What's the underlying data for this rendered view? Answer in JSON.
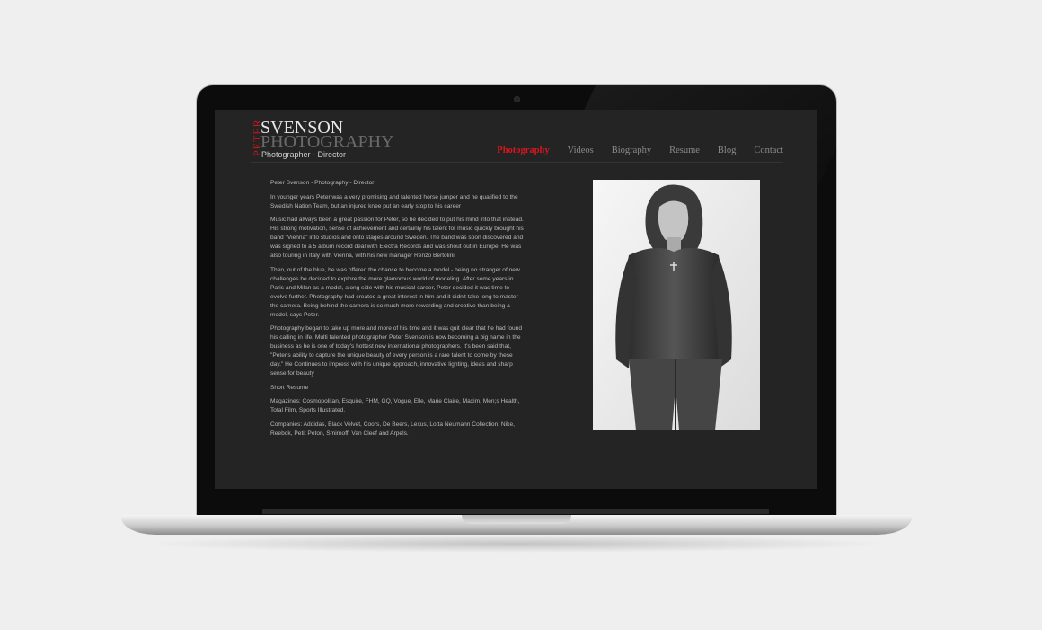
{
  "site": {
    "logo_peter": "PETER",
    "logo_svenson": "SVENSON",
    "logo_photography": "PHOTOGRAPHY",
    "logo_subtitle": "Photographer - Director"
  },
  "nav": {
    "items": [
      {
        "label": "Photography",
        "active": true
      },
      {
        "label": "Videos",
        "active": false
      },
      {
        "label": "Biography",
        "active": false
      },
      {
        "label": "Resume",
        "active": false
      },
      {
        "label": "Blog",
        "active": false
      },
      {
        "label": "Contact",
        "active": false
      }
    ]
  },
  "content": {
    "heading": "Peter Svenson - Photography - Director",
    "paragraphs": [
      "In younger years Peter was a very promising and talented horse jumper and he qualified to the Swedish Nation Team, but an injured knee put an early stop to his career",
      "Music had always been a great passion for Peter, so he decided to put his mind into that instead. His strong motivation, sense of achievement and certainly his talent for music quickly brought his band \"Vienna\" into studios and onto stages around Sweden. The band was soon discovered and was signed to a 5 album record deal with Electra Records and was shout out in Europe. He was also touring in Italy with Vienna, with his new manager Renzo Bertolini",
      "Then, out of the blue, he was offered the chance to become a model - being no stranger of new challenges he decided to explore the more glamorous world of modeling. After some years in Paris and Milan as a model, along side with his musical career, Peter decided it was time to evolve further. Photography had created a great interest in him and it didn't take long to master the camera. Being behind the camera is so much more rewarding and creative than being a model, says Peter.",
      "Photography began to take up more and more of his time and it was quit clear that he had found his calling in life. Multi talented photographer Peter Svenson is now becoming a big name in the business as he is one of today's hottest new international photographers. It's been said that, \"Peter's ability to capture the unique beauty of every person is a rare talent to come by these day.\" He Continues to impress with his unique approach, innovative lighting, ideas and sharp sense for beauty",
      "Short Resume",
      "Magazines: Cosmopolitan, Esquire, FHM, GQ, Vogue, Elle, Marie Claire, Maxim, Men;s Health, Total Film, Sports Illustrated.",
      "Companies: Addidas, Black Velvet, Coors, De Beers, Lexus, Lotta Neumann Collection, Nike, Reebok, Petit Peton, Smirnoff, Van Cleef and Arpels."
    ]
  },
  "colors": {
    "accent": "#d8161d",
    "screen_bg": "#242424",
    "page_bg": "#efefef"
  }
}
